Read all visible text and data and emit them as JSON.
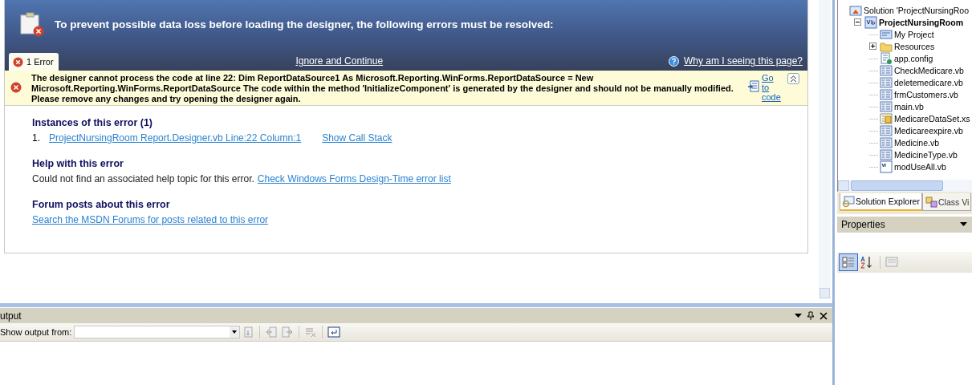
{
  "designer_error": {
    "header": {
      "message": "To prevent possible data loss before loading the designer, the following errors must be resolved:"
    },
    "tabs": [
      {
        "label": "1 Error",
        "selected": true
      }
    ],
    "ignore_link": "Ignore and Continue",
    "help_link": "Why am I seeing this page?",
    "error": {
      "message": "The designer cannot process the code at line 22: Dim ReportDataSource1 As Microsoft.Reporting.WinForms.ReportDataSource = New Microsoft.Reporting.WinForms.ReportDataSource The code within the method 'InitializeComponent' is generated by the designer and should not be manually modified. Please remove any changes and try opening the designer again.",
      "go_to_code": "Go to code",
      "expanded": true
    },
    "sections": [
      {
        "kind": "instances",
        "heading": "Instances of this error (1)",
        "items": [
          {
            "number": "1.",
            "link": "ProjectNursingRoom Report.Designer.vb Line:22 Column:1",
            "call_stack": "Show Call Stack"
          }
        ]
      },
      {
        "kind": "help",
        "heading": "Help with this error",
        "text": "Could not find an associated help topic for this error.",
        "link": "Check Windows Forms Design-Time error list"
      },
      {
        "kind": "forum",
        "heading": "Forum posts about this error",
        "link": "Search the MSDN Forums for posts related to this error"
      }
    ]
  },
  "output": {
    "title": "utput",
    "show_from_label": "Show output from:"
  },
  "solution_explorer": {
    "tree": [
      {
        "label": "Solution 'ProjectNursingRoo",
        "kind": "solution",
        "children": [
          {
            "label": "ProjectNursingRoom",
            "kind": "vbproject",
            "bold": true,
            "expanded": true,
            "children": [
              {
                "label": "My Project",
                "kind": "myproject"
              },
              {
                "label": "Resources",
                "kind": "folder",
                "expanded": false
              },
              {
                "label": "app.config",
                "kind": "config"
              },
              {
                "label": "CheckMedicare.vb",
                "kind": "vbfile"
              },
              {
                "label": "deletemedicare.vb",
                "kind": "vbfile"
              },
              {
                "label": "frmCustomers.vb",
                "kind": "vbfile"
              },
              {
                "label": "main.vb",
                "kind": "vbfile"
              },
              {
                "label": "MedicareDataSet.xs",
                "kind": "dataset"
              },
              {
                "label": "Medicareexpire.vb",
                "kind": "vbfile"
              },
              {
                "label": "Medicine.vb",
                "kind": "vbfile"
              },
              {
                "label": "MedicineType.vb",
                "kind": "vbfile"
              },
              {
                "label": "modUseAll.vb",
                "kind": "module"
              }
            ]
          }
        ]
      }
    ],
    "tabs": [
      {
        "label": "Solution Explorer",
        "selected": true
      },
      {
        "label": "Class Vi",
        "selected": false
      }
    ]
  },
  "properties": {
    "title": "Properties"
  }
}
